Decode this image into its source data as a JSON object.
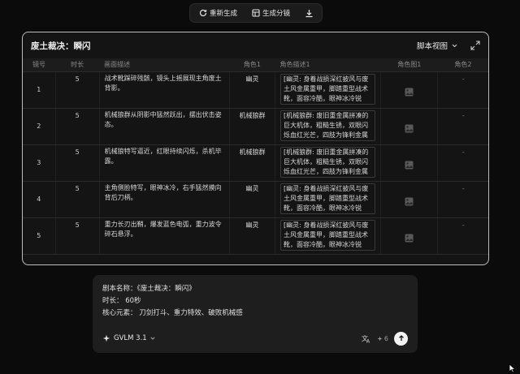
{
  "toolbar": {
    "regenerate_label": "重新生成",
    "storyboard_label": "生成分镜",
    "download_icon": "download-icon"
  },
  "panel": {
    "title": "废土裁决：瞬闪",
    "view_label": "脚本视图"
  },
  "table": {
    "headers": [
      "镜号",
      "时长",
      "画面描述",
      "角色1",
      "角色描述1",
      "角色图1",
      "角色2"
    ],
    "rows": [
      {
        "idx": "1",
        "dur": "5",
        "desc": "战术靴踩碎残骸，镜头上摇展现主角废土背影。",
        "role": "幽灵",
        "role_desc": "[幽灵: 身着战损深红披风与废土风金属重甲，脚踏重型战术靴，面容冷酷，眼神冰冷锐",
        "role2": "-"
      },
      {
        "idx": "2",
        "dur": "5",
        "desc": "机械狼群从阴影中猛然跃出，摆出伏击姿态。",
        "role": "机械狼群",
        "role_desc": "[机械狼群: 废旧重金属拼凑的巨大机体，粗糙生锈，双眼闪烁血红光芒，四肢为锋利金属",
        "role2": "-"
      },
      {
        "idx": "3",
        "dur": "5",
        "desc": "机械狼特写逼近，红眼持续闪烁，杀机毕露。",
        "role": "机械狼群",
        "role_desc": "[机械狼群: 废旧重金属拼凑的巨大机体，粗糙生锈，双眼闪烁血红光芒，四肢为锋利金属",
        "role2": "-"
      },
      {
        "idx": "4",
        "dur": "5",
        "desc": "主角侧脸特写，眼神冰冷，右手猛然摸向背后刀柄。",
        "role": "幽灵",
        "role_desc": "[幽灵: 身着战损深红披风与废土风金属重甲，脚踏重型战术靴，面容冷酷，眼神冰冷锐",
        "role2": "-"
      },
      {
        "idx": "5",
        "dur": "5",
        "desc": "重力长刃出鞘，爆发蓝色电弧，重力波令碎石悬浮。",
        "role": "幽灵",
        "role_desc": "[幽灵: 身着战损深红披风与废土风金属重甲，脚踏重型战术靴，面容冷酷，眼神冰冷锐",
        "role2": "-"
      }
    ]
  },
  "chat": {
    "line1": "剧本名称：《废土裁决：瞬闪》",
    "line2": "时长： 60秒",
    "line3": "核心元素： 刀剑打斗、重力特效、破败机械感",
    "model": "GVLM 3.1",
    "credits": "6"
  }
}
